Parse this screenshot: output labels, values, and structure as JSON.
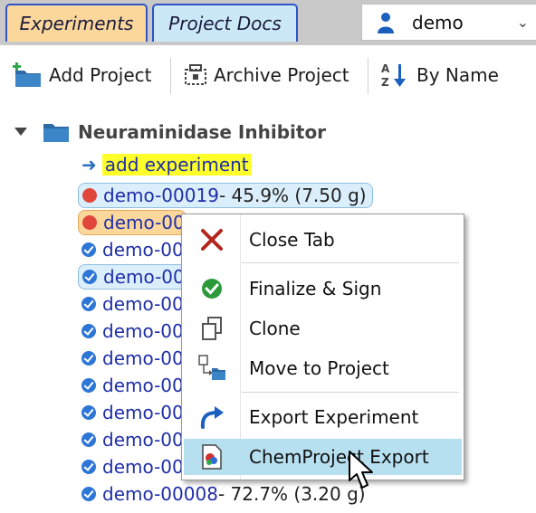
{
  "tabs": [
    {
      "label": "Experiments",
      "active": true
    },
    {
      "label": "Project Docs",
      "active": false
    }
  ],
  "user_select": {
    "value": "demo"
  },
  "toolbar": {
    "add_project": "Add Project",
    "archive_project": "Archive Project",
    "sort_by": "By Name"
  },
  "tree": {
    "root_label": "Neuraminidase Inhibitor",
    "add_experiment": "add experiment",
    "experiments": [
      {
        "name": "demo-00019",
        "detail": " - 45.9% (7.50 g)",
        "status": "open"
      },
      {
        "name": "demo-00",
        "detail": "",
        "status": "open"
      },
      {
        "name": "demo-00",
        "detail": "",
        "status": "signed"
      },
      {
        "name": "demo-00",
        "detail": "",
        "status": "signed"
      },
      {
        "name": "demo-00",
        "detail": "",
        "status": "signed"
      },
      {
        "name": "demo-00",
        "detail": "",
        "status": "signed"
      },
      {
        "name": "demo-00",
        "detail": "",
        "status": "signed"
      },
      {
        "name": "demo-00",
        "detail": "",
        "status": "signed"
      },
      {
        "name": "demo-00",
        "detail": "",
        "status": "signed"
      },
      {
        "name": "demo-00",
        "detail": "",
        "status": "signed"
      },
      {
        "name": "demo-00",
        "detail": "",
        "status": "signed"
      },
      {
        "name": "demo-00",
        "detail": "",
        "status": "signed"
      },
      {
        "name": "demo-00008",
        "detail": " - 72.7% (3.20 g)",
        "status": "signed"
      }
    ]
  },
  "context_menu": {
    "items": [
      {
        "label": "Close Tab",
        "icon": "close-x-icon"
      },
      {
        "label": "Finalize & Sign",
        "icon": "green-check-icon"
      },
      {
        "label": "Clone",
        "icon": "clone-icon"
      },
      {
        "label": "Move to Project",
        "icon": "move-to-project-icon"
      },
      {
        "label": "Export Experiment",
        "icon": "export-arrow-icon"
      },
      {
        "label": "ChemProject Export",
        "icon": "chemproject-icon",
        "highlighted": true
      }
    ]
  },
  "colors": {
    "tab_active": "#fbd79c",
    "tab_inactive": "#cbe8f6",
    "link_blue": "#1f2fa8",
    "highlight_yellow": "#ffff2a",
    "menu_highlight": "#b6dff0",
    "status_open": "#e0473a",
    "status_signed": "#2d76d6"
  }
}
